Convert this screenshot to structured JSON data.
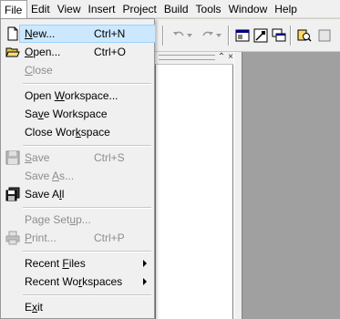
{
  "menubar": {
    "items": [
      {
        "label": "File"
      },
      {
        "label": "Edit"
      },
      {
        "label": "View"
      },
      {
        "label": "Insert"
      },
      {
        "label": "Project"
      },
      {
        "label": "Build"
      },
      {
        "label": "Tools"
      },
      {
        "label": "Window"
      },
      {
        "label": "Help"
      }
    ]
  },
  "file_menu": {
    "items": [
      {
        "label": "New...",
        "shortcut": "Ctrl+N",
        "icon": "new-document-icon",
        "state": "highlighted"
      },
      {
        "label": "Open...",
        "shortcut": "Ctrl+O",
        "icon": "open-folder-icon",
        "state": "enabled"
      },
      {
        "label": "Close",
        "shortcut": "",
        "state": "disabled"
      },
      {
        "label": "Open Workspace...",
        "shortcut": "",
        "state": "enabled"
      },
      {
        "label": "Save Workspace",
        "shortcut": "",
        "state": "enabled"
      },
      {
        "label": "Close Workspace",
        "shortcut": "",
        "state": "enabled"
      },
      {
        "label": "Save",
        "shortcut": "Ctrl+S",
        "icon": "save-icon",
        "state": "disabled"
      },
      {
        "label": "Save As...",
        "shortcut": "",
        "state": "disabled"
      },
      {
        "label": "Save All",
        "shortcut": "",
        "icon": "save-all-icon",
        "state": "enabled"
      },
      {
        "label": "Page Setup...",
        "shortcut": "",
        "state": "disabled"
      },
      {
        "label": "Print...",
        "shortcut": "Ctrl+P",
        "icon": "print-icon",
        "state": "disabled"
      },
      {
        "label": "Recent Files",
        "shortcut": "",
        "submenu": true,
        "state": "enabled"
      },
      {
        "label": "Recent Workspaces",
        "shortcut": "",
        "submenu": true,
        "state": "enabled"
      },
      {
        "label": "Exit",
        "shortcut": "",
        "state": "enabled"
      }
    ]
  },
  "toolbar": {
    "buttons": [
      {
        "icon": "undo-icon"
      },
      {
        "icon": "redo-icon"
      },
      {
        "icon": "workspace-icon"
      },
      {
        "icon": "output-icon"
      },
      {
        "icon": "window-list-icon"
      },
      {
        "icon": "find-icon"
      }
    ]
  },
  "pane": {
    "close_glyph": "×",
    "restore_glyph": "⌃"
  },
  "colors": {
    "menu_background": "#f0f0f0",
    "highlight_background": "#cce8ff",
    "highlight_border": "#99d1ff",
    "disabled_text": "#8d8d8d",
    "mdi_background": "#a0a0a0"
  }
}
